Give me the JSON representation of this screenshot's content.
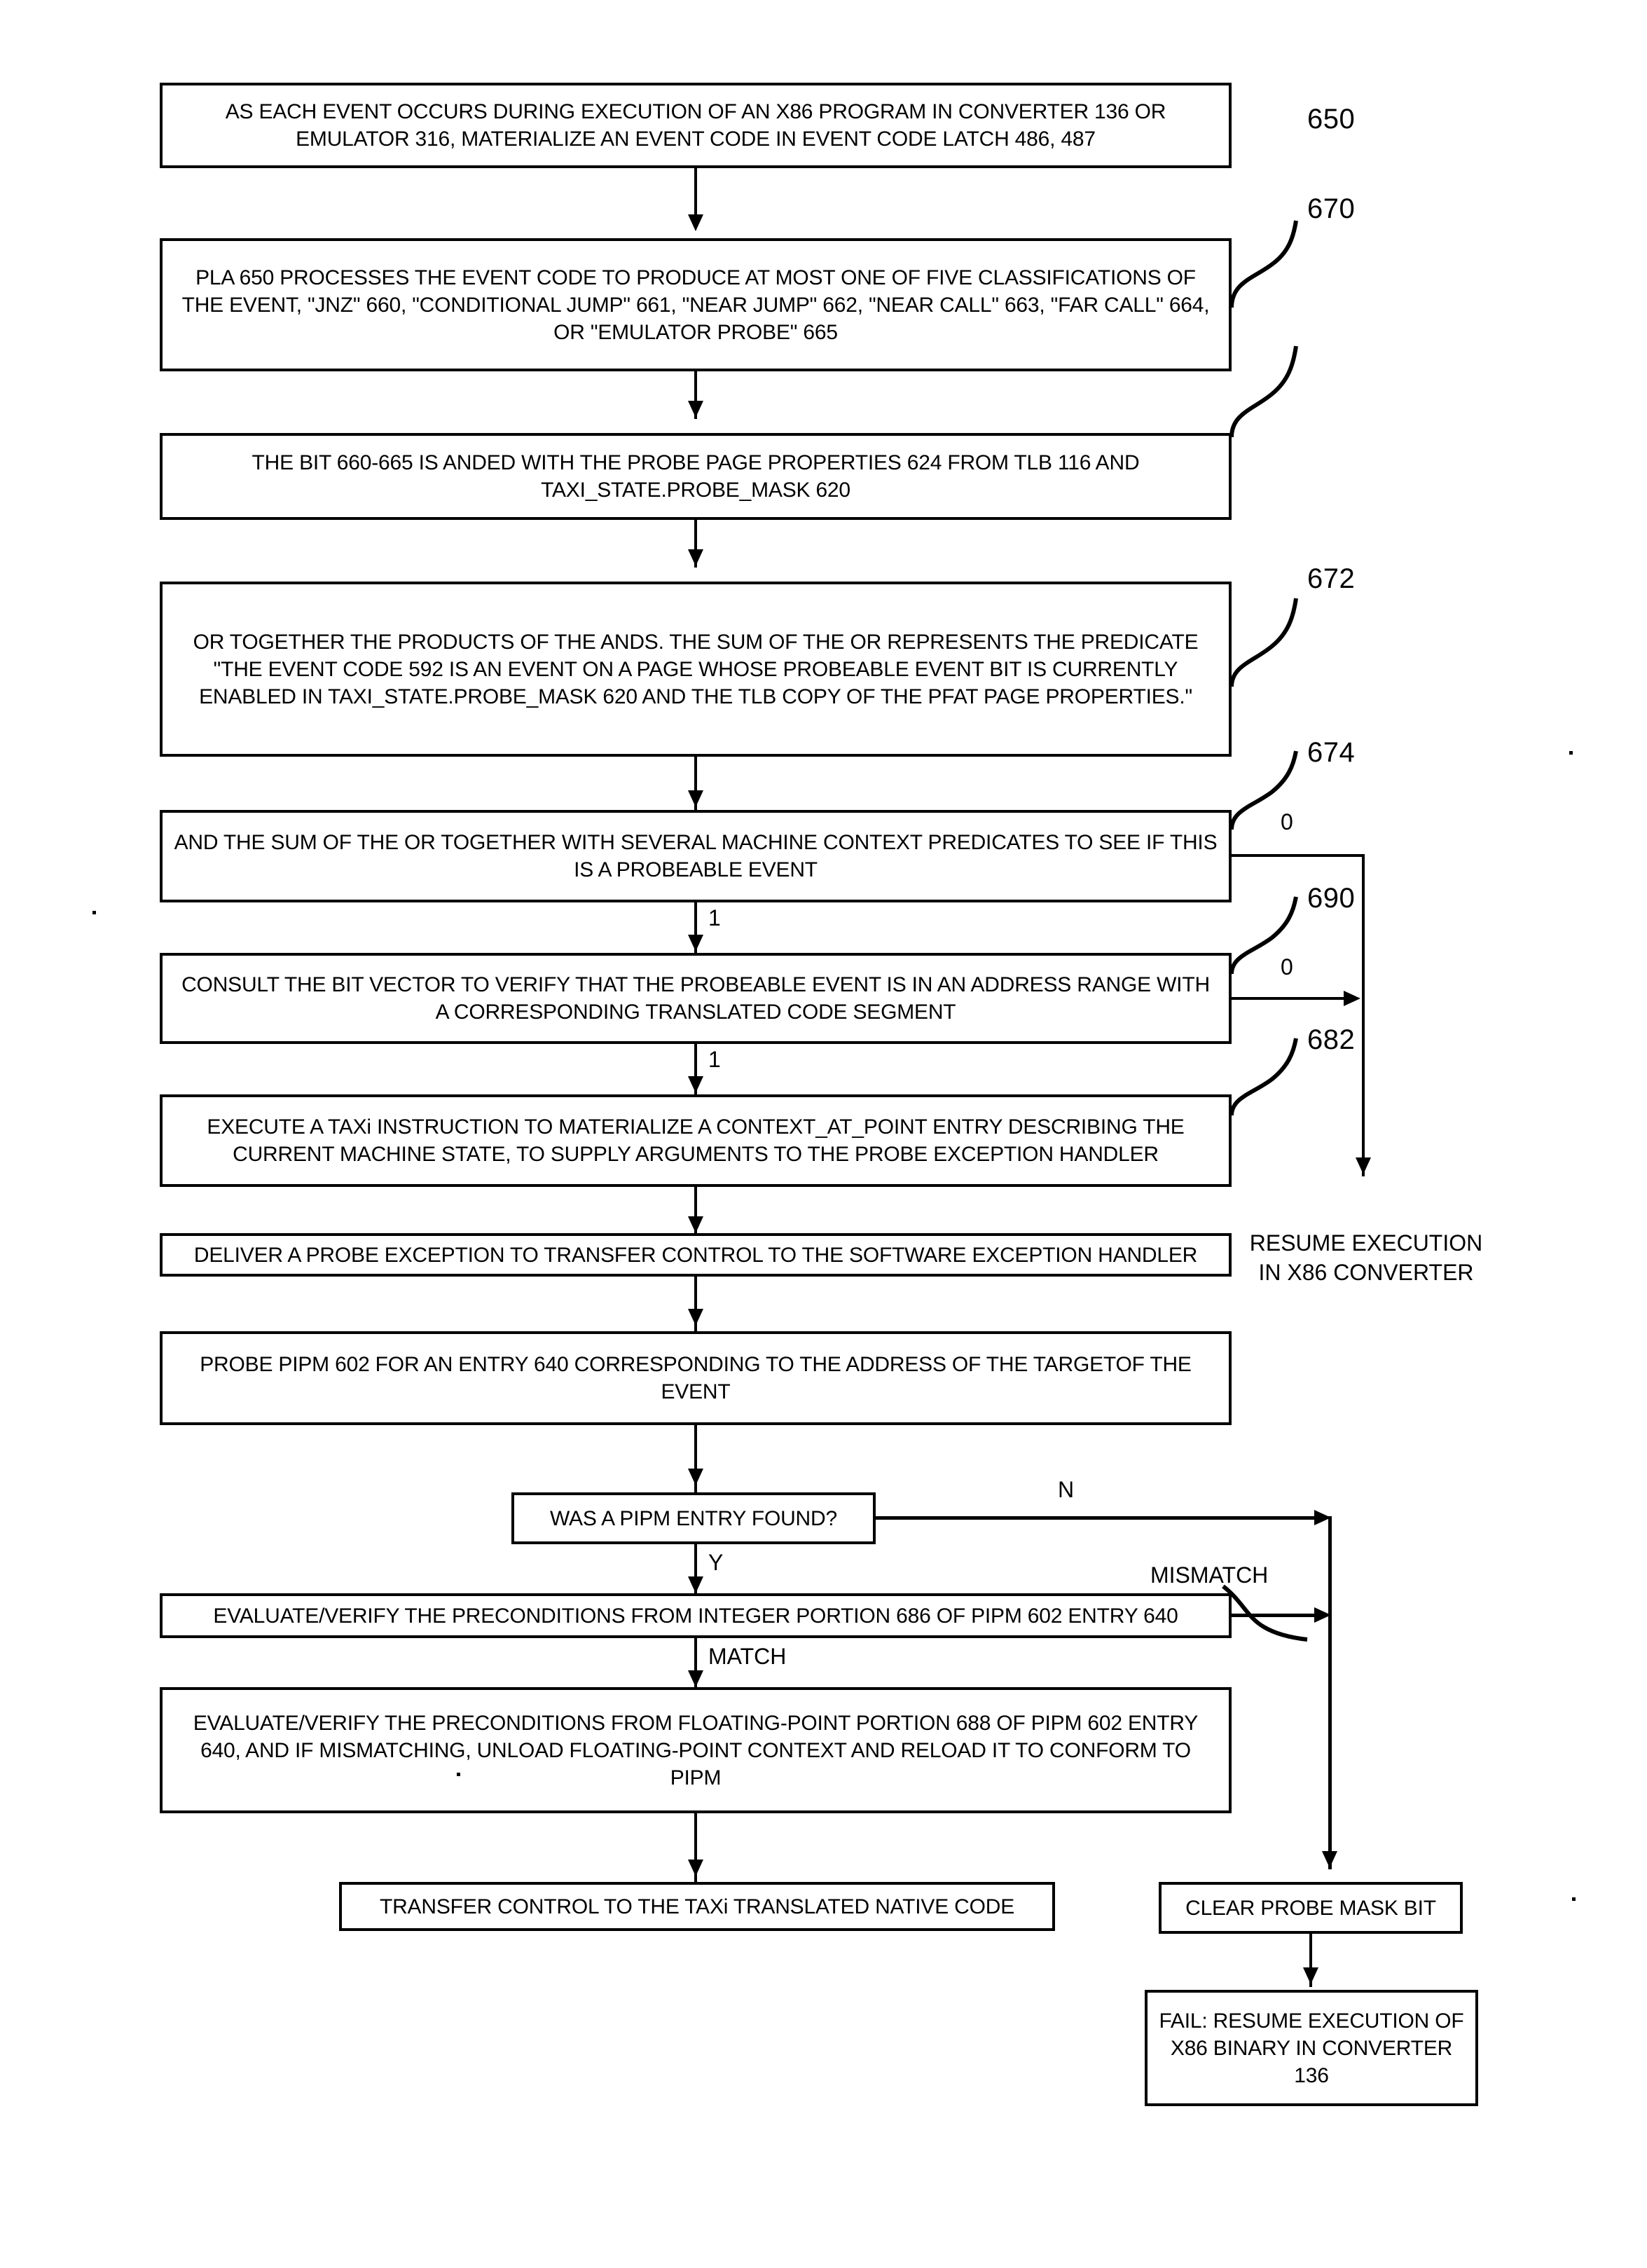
{
  "figure": {
    "type": "patent-flowchart",
    "nodes": [
      {
        "id": "n1",
        "name": "materialize-event-code",
        "shape": "process",
        "text": "AS EACH EVENT OCCURS DURING EXECUTION OF AN X86 PROGRAM IN CONVERTER 136 OR EMULATOR 316, MATERIALIZE AN EVENT CODE IN EVENT CODE LATCH 486, 487",
        "ref": null
      },
      {
        "id": "n2",
        "name": "pla-classify-event",
        "shape": "process",
        "text": "PLA 650 PROCESSES THE EVENT CODE TO PRODUCE AT MOST ONE OF FIVE CLASSIFICATIONS OF THE EVENT, \"JNZ\" 660, \"CONDITIONAL JUMP\" 661, \"NEAR JUMP\" 662, \"NEAR CALL\" 663, \"FAR CALL\" 664, OR \"EMULATOR PROBE\" 665",
        "ref": "650"
      },
      {
        "id": "n3",
        "name": "and-bit-with-probe-page-properties",
        "shape": "process",
        "text": "THE BIT 660-665 IS ANDED WITH THE PROBE PAGE PROPERTIES 624 FROM TLB 116 AND TAXI_STATE.PROBE_MASK 620",
        "ref": "670"
      },
      {
        "id": "n4",
        "name": "or-together-products-of-ands",
        "shape": "process",
        "text": "OR TOGETHER THE PRODUCTS OF THE ANDS.  THE SUM OF THE OR REPRESENTS THE PREDICATE \"THE EVENT CODE 592 IS AN EVENT ON A PAGE WHOSE PROBEABLE EVENT BIT IS CURRENTLY ENABLED IN TAXI_STATE.PROBE_MASK 620 AND THE TLB COPY OF THE PFAT PAGE PROPERTIES.\"",
        "ref": "672"
      },
      {
        "id": "n5",
        "name": "and-sum-with-machine-context-predicates",
        "shape": "process",
        "text": "AND THE SUM OF THE OR TOGETHER WITH SEVERAL MACHINE CONTEXT PREDICATES TO SEE IF THIS IS A PROBEABLE EVENT",
        "ref": "674"
      },
      {
        "id": "n6",
        "name": "consult-bit-vector",
        "shape": "process",
        "text": "CONSULT THE BIT VECTOR TO VERIFY THAT THE PROBEABLE EVENT IS IN AN ADDRESS RANGE WITH A CORRESPONDING TRANSLATED CODE SEGMENT",
        "ref": "690"
      },
      {
        "id": "n7",
        "name": "execute-taxi-instruction",
        "shape": "process",
        "text": "EXECUTE A TAXi INSTRUCTION TO MATERIALIZE A CONTEXT_AT_POINT ENTRY DESCRIBING THE CURRENT MACHINE STATE, TO SUPPLY ARGUMENTS TO THE PROBE EXCEPTION HANDLER",
        "ref": "682"
      },
      {
        "id": "n8",
        "name": "deliver-probe-exception",
        "shape": "process",
        "text": "DELIVER A PROBE EXCEPTION TO TRANSFER CONTROL TO THE SOFTWARE EXCEPTION HANDLER",
        "ref": null
      },
      {
        "id": "n9",
        "name": "probe-pipm-for-entry",
        "shape": "process",
        "text": "PROBE PIPM 602 FOR AN ENTRY 640 CORRESPONDING TO THE ADDRESS OF THE TARGETOF THE EVENT",
        "ref": null
      },
      {
        "id": "n10",
        "name": "was-pipm-entry-found",
        "shape": "decision",
        "text": "WAS A PIPM ENTRY FOUND?",
        "ref": null
      },
      {
        "id": "n11",
        "name": "verify-integer-preconditions",
        "shape": "process",
        "text": "EVALUATE/VERIFY THE PRECONDITIONS FROM INTEGER PORTION 686 OF PIPM 602 ENTRY 640",
        "ref": null
      },
      {
        "id": "n12",
        "name": "verify-floating-point-preconditions",
        "shape": "process",
        "text": "EVALUATE/VERIFY THE PRECONDITIONS FROM FLOATING-POINT PORTION 688 OF PIPM 602 ENTRY 640, AND IF MISMATCHING, UNLOAD FLOATING-POINT CONTEXT AND RELOAD IT TO CONFORM TO PIPM",
        "ref": null
      },
      {
        "id": "n13",
        "name": "transfer-control-to-native-code",
        "shape": "process",
        "text": "TRANSFER CONTROL TO THE TAXi TRANSLATED NATIVE CODE",
        "ref": null
      },
      {
        "id": "n14",
        "name": "clear-probe-mask-bit",
        "shape": "process",
        "text": "CLEAR PROBE MASK BIT",
        "ref": null
      },
      {
        "id": "n15",
        "name": "fail-resume-execution",
        "shape": "process",
        "text": "FAIL: RESUME EXECUTION OF X86 BINARY IN CONVERTER 136",
        "ref": null
      }
    ],
    "terminal_text": {
      "resume_execution": "RESUME EXECUTION\nIN X86 CONVERTER"
    },
    "reference_numerals": {
      "r650": "650",
      "r670": "670",
      "r672": "672",
      "r674": "674",
      "r690": "690",
      "r682": "682"
    },
    "branch_labels": {
      "n5_false": "0",
      "n5_true": "1",
      "n6_false": "0",
      "n6_true": "1",
      "n10_no": "N",
      "n10_yes": "Y",
      "n11_mismatch": "MISMATCH",
      "n11_match": "MATCH"
    }
  }
}
